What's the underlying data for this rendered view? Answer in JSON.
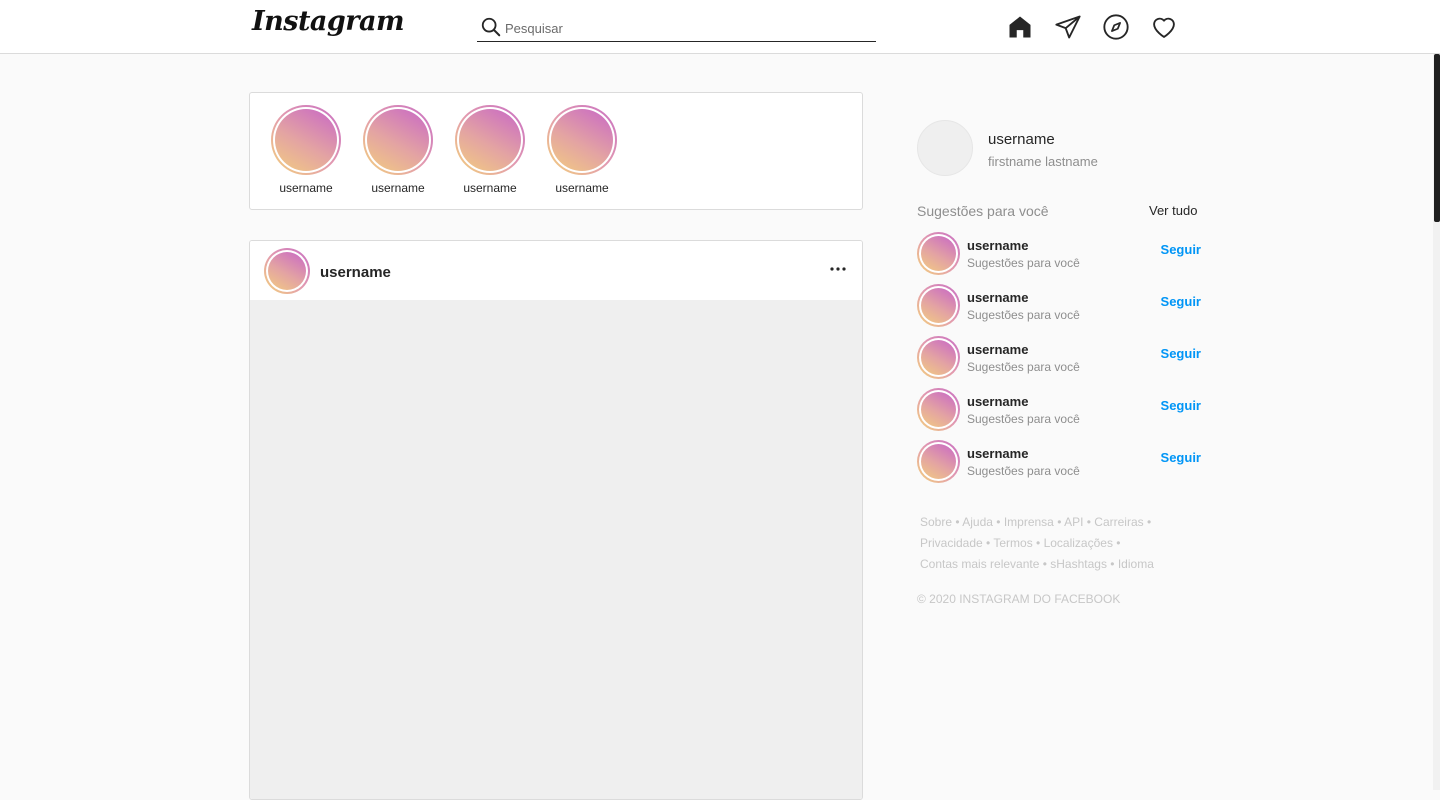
{
  "header": {
    "logo": "Instagram",
    "search_placeholder": "Pesquisar",
    "icons": [
      "home-icon",
      "direct-icon",
      "explore-icon",
      "activity-icon"
    ]
  },
  "stories": [
    {
      "username": "username"
    },
    {
      "username": "username"
    },
    {
      "username": "username"
    },
    {
      "username": "username"
    }
  ],
  "post": {
    "username": "username",
    "more_icon": "more-options-icon"
  },
  "sidebar": {
    "profile": {
      "username": "username",
      "fullname": "firstname lastname"
    },
    "suggestions_title": "Sugestões para você",
    "see_all": "Ver tudo",
    "suggestions": [
      {
        "username": "username",
        "subtitle": "Sugestões para você",
        "action": "Seguir"
      },
      {
        "username": "username",
        "subtitle": "Sugestões para você",
        "action": "Seguir"
      },
      {
        "username": "username",
        "subtitle": "Sugestões para você",
        "action": "Seguir"
      },
      {
        "username": "username",
        "subtitle": "Sugestões para você",
        "action": "Seguir"
      },
      {
        "username": "username",
        "subtitle": "Sugestões para você",
        "action": "Seguir"
      }
    ],
    "footer_links": [
      [
        "Sobre",
        "Ajuda",
        "Imprensa",
        "API",
        "Carreiras"
      ],
      [
        "Privacidade",
        "Termos",
        "Localizações"
      ],
      [
        "Contas mais relevante",
        "sHashtags",
        "Idioma"
      ]
    ],
    "copyright": "© 2020 INSTAGRAM DO FACEBOOK"
  },
  "colors": {
    "accent": "#0095f6",
    "story_gradient": [
      "#f3d27a",
      "#e29ab0",
      "#c86fc3"
    ]
  }
}
